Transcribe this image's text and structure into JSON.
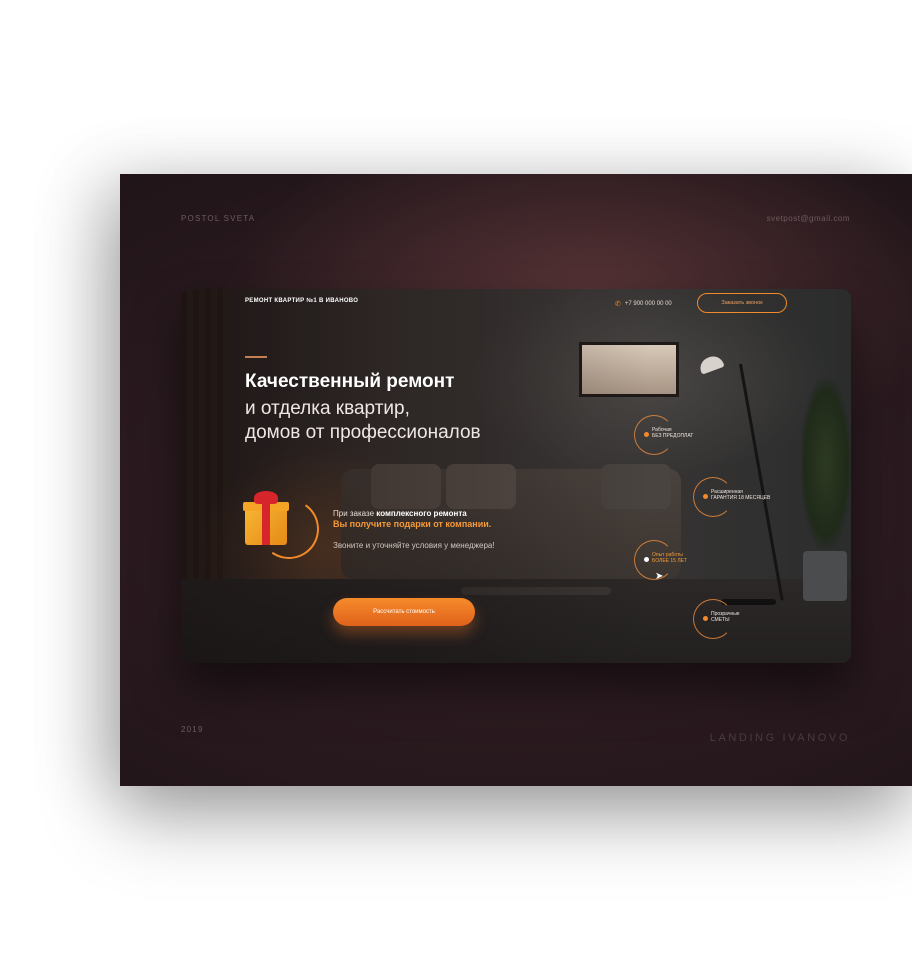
{
  "poster": {
    "author": "POSTOL SVETA",
    "email": "svetpost@gmail.com",
    "year": "2019",
    "project": "LANDING IVANOVO"
  },
  "landing": {
    "brand": "РЕМОНТ КВАРТИР №1 В ИВАНОВО",
    "phone": "+7 900 000 00 00",
    "callback_label": "Заказать звонок",
    "headline_bold": "Качественный ремонт",
    "headline_line2": "и отделка квартир,",
    "headline_line3": "домов от профессионалов",
    "offer_prefix": "При заказе ",
    "offer_bold": "комплексного ремонта",
    "offer_highlight": "Вы получите подарки от компании.",
    "offer_note": "Звоните и уточняйте условия у менеджера!",
    "cta_label": "Рассчитать стоимость",
    "features": [
      {
        "line1": "Рабочая",
        "line2": "БЕЗ ПРЕДОПЛАТ"
      },
      {
        "line1": "Расширенная",
        "line2": "ГАРАНТИЯ 18 МЕСЯЦЕВ"
      },
      {
        "line1": "Опыт работы",
        "line2": "БОЛЕЕ 15 ЛЕТ"
      },
      {
        "line1": "Прозрачные",
        "line2": "СМЕТЫ"
      }
    ],
    "accent_color": "#F08A2A",
    "icons": [
      "phone-icon",
      "gift-icon",
      "cursor-icon"
    ]
  }
}
